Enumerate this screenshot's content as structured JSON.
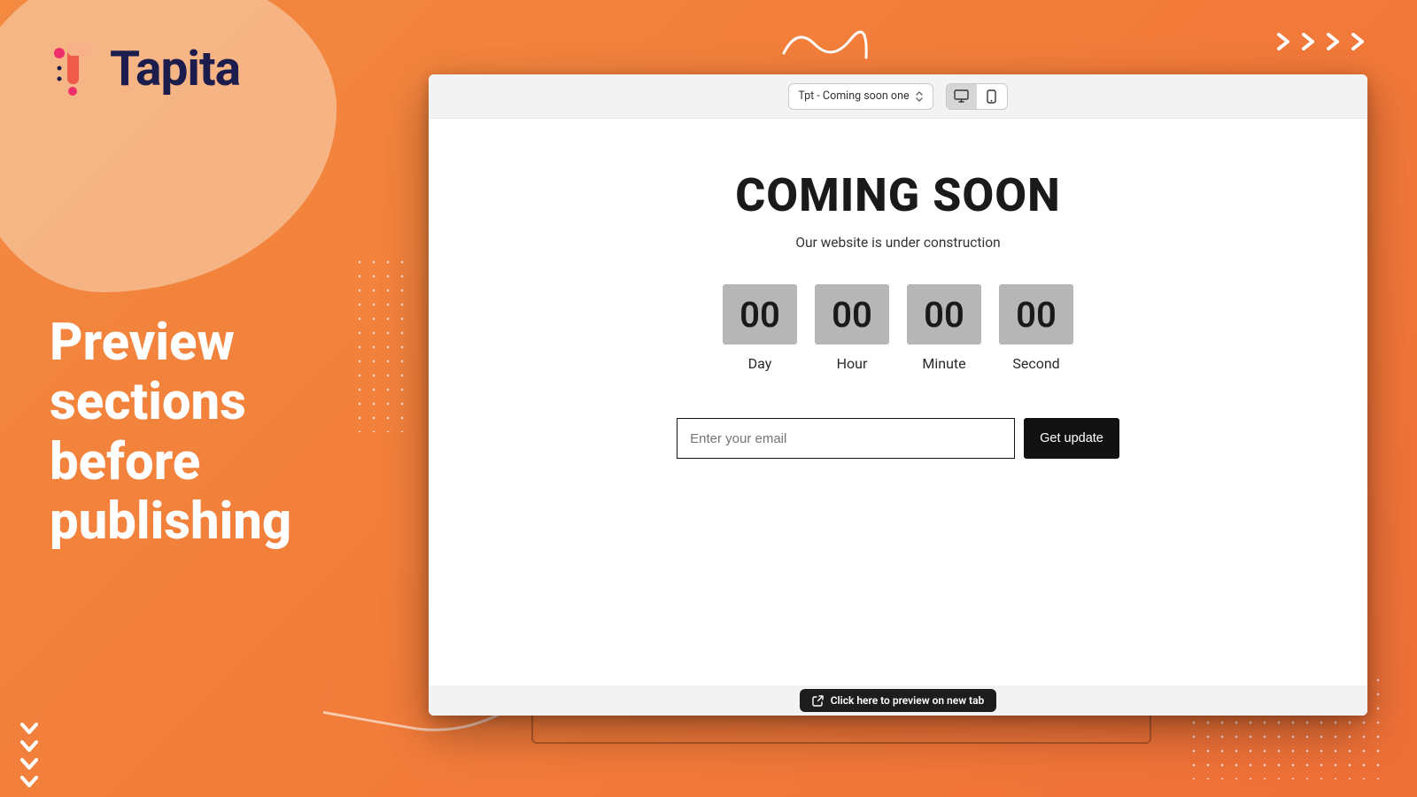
{
  "brand": {
    "name": "Tapita"
  },
  "headline": "Preview sections before publishing",
  "toolbar": {
    "template_selected": "Tpt - Coming soon one"
  },
  "page": {
    "title": "COMING SOON",
    "subtitle": "Our website is under construction",
    "countdown": [
      {
        "value": "00",
        "label": "Day"
      },
      {
        "value": "00",
        "label": "Hour"
      },
      {
        "value": "00",
        "label": "Minute"
      },
      {
        "value": "00",
        "label": "Second"
      }
    ],
    "email_placeholder": "Enter your email",
    "cta_label": "Get update"
  },
  "footer": {
    "preview_label": "Click here to preview on new tab"
  }
}
